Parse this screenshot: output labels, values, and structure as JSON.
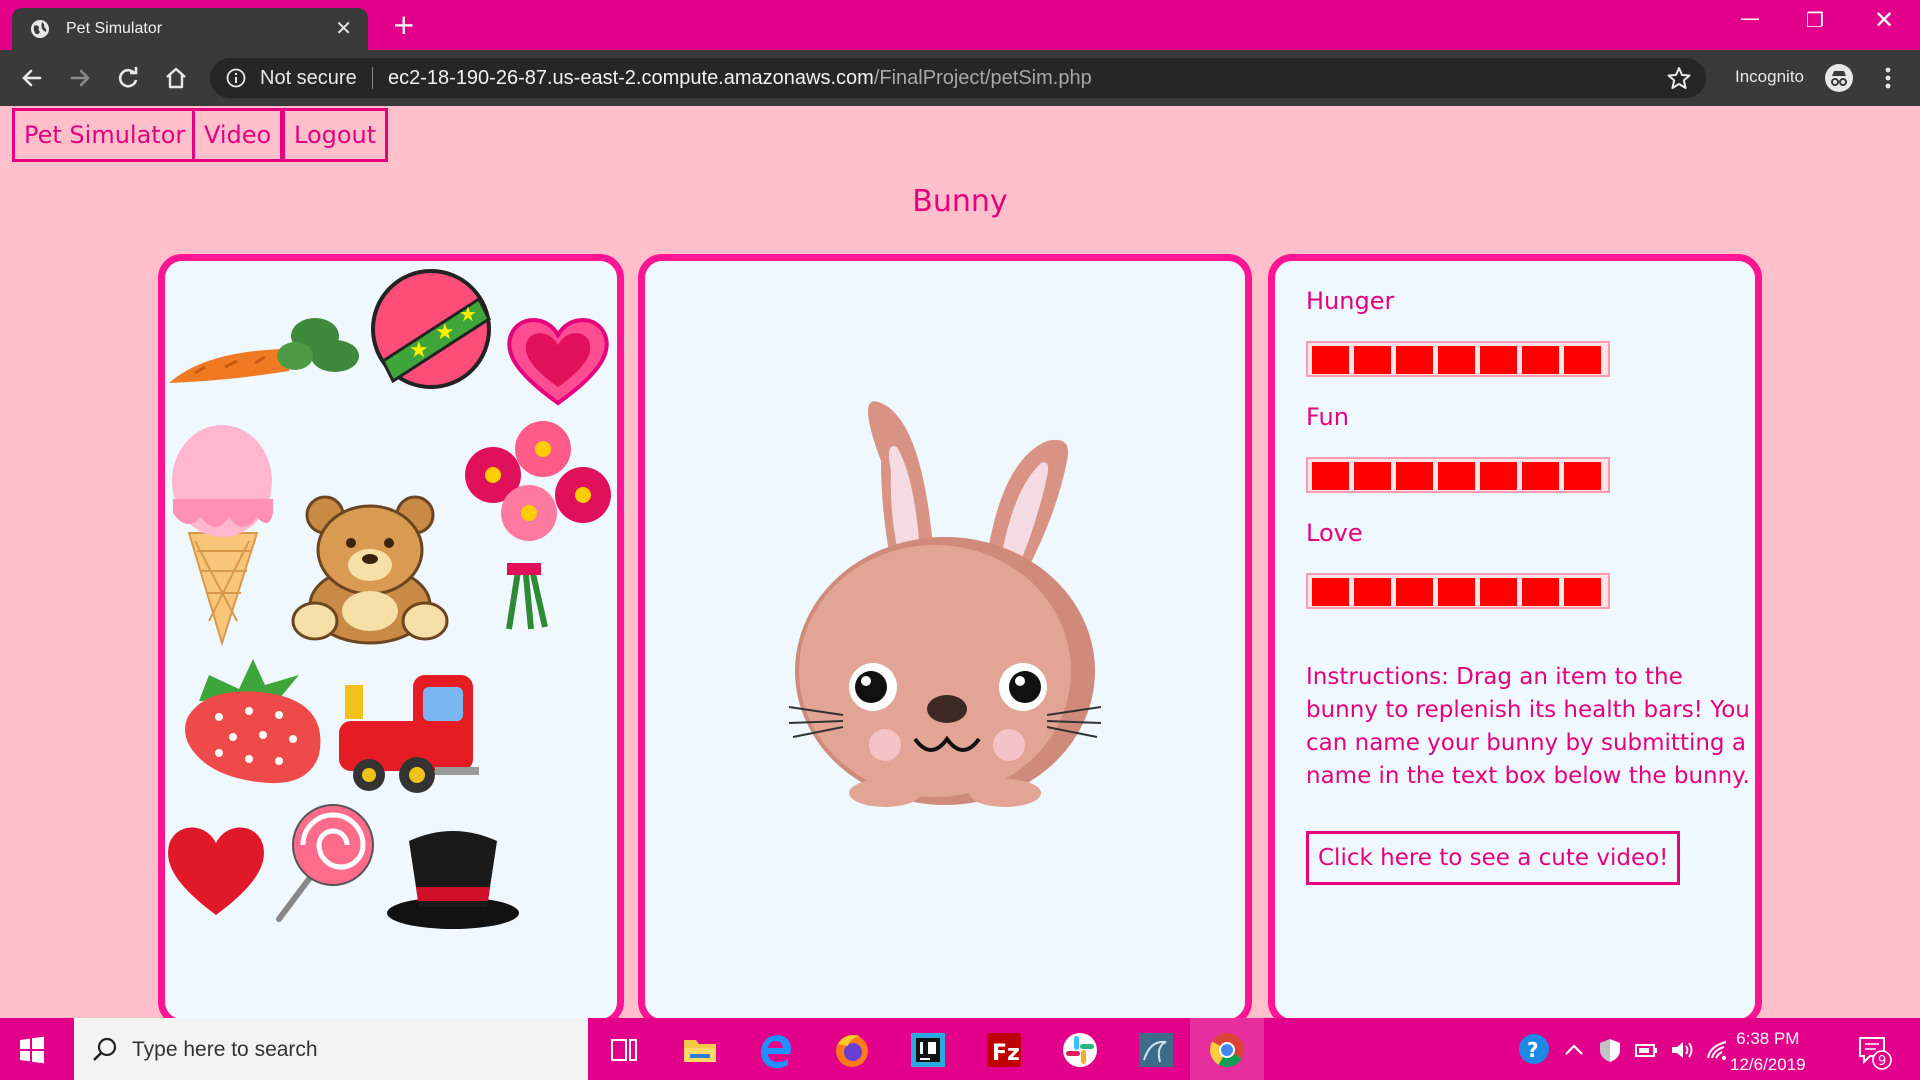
{
  "browser": {
    "tab_title": "Pet Simulator",
    "security_label": "Not secure",
    "url_host": "ec2-18-190-26-87.us-east-2.compute.amazonaws.com",
    "url_path": "/FinalProject/petSim.php",
    "incognito_label": "Incognito"
  },
  "nav": {
    "items": [
      "Pet Simulator",
      "Video",
      "Logout"
    ]
  },
  "pet": {
    "name": "Bunny",
    "items": [
      "carrot",
      "ball",
      "heart",
      "ice-cream",
      "teddy-bear",
      "flowers",
      "strawberry",
      "toy-train",
      "red-heart",
      "lollipop",
      "top-hat"
    ]
  },
  "stats": {
    "hunger": {
      "label": "Hunger",
      "level": 7,
      "max": 7
    },
    "fun": {
      "label": "Fun",
      "level": 7,
      "max": 7
    },
    "love": {
      "label": "Love",
      "level": 7,
      "max": 7
    },
    "bar_color": "#ff0000",
    "instructions": "Instructions: Drag an item to the bunny to replenish its health bars! You can name your bunny by submitting a name in the text box below the bunny.",
    "video_button": "Click here to see a cute video!"
  },
  "taskbar": {
    "search_placeholder": "Type here to search",
    "time": "6:38 PM",
    "date": "12/6/2019",
    "notification_count": "9",
    "apps": [
      "task-view",
      "file-explorer",
      "edge",
      "firefox",
      "intellij",
      "filezilla",
      "slack",
      "mysql-workbench",
      "chrome"
    ]
  },
  "colors": {
    "accent": "#e6007e",
    "panel_border": "#ff1493",
    "page_bg": "#ffbfcb",
    "panel_bg": "#f0f8ff",
    "browser_frame": "#e2008a"
  }
}
